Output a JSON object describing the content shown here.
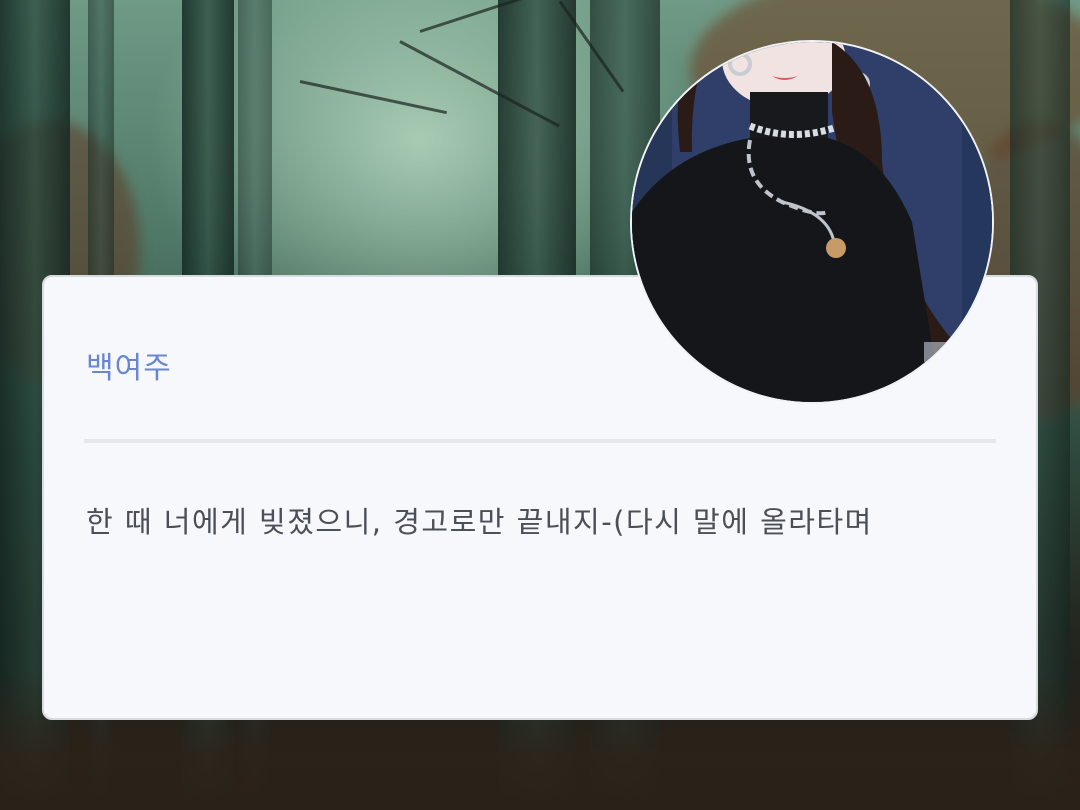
{
  "character": {
    "name": "백여주"
  },
  "dialogue": {
    "text": "한 때 너에게 빚졌으니, 경고로만 끝내지-(다시 말에 올라타며"
  },
  "portrait": {
    "icon": "character-portrait"
  },
  "colors": {
    "name_accent": "#6a86d3",
    "card_background": "#f6f8fb",
    "dialogue_text": "#4b4f57"
  }
}
